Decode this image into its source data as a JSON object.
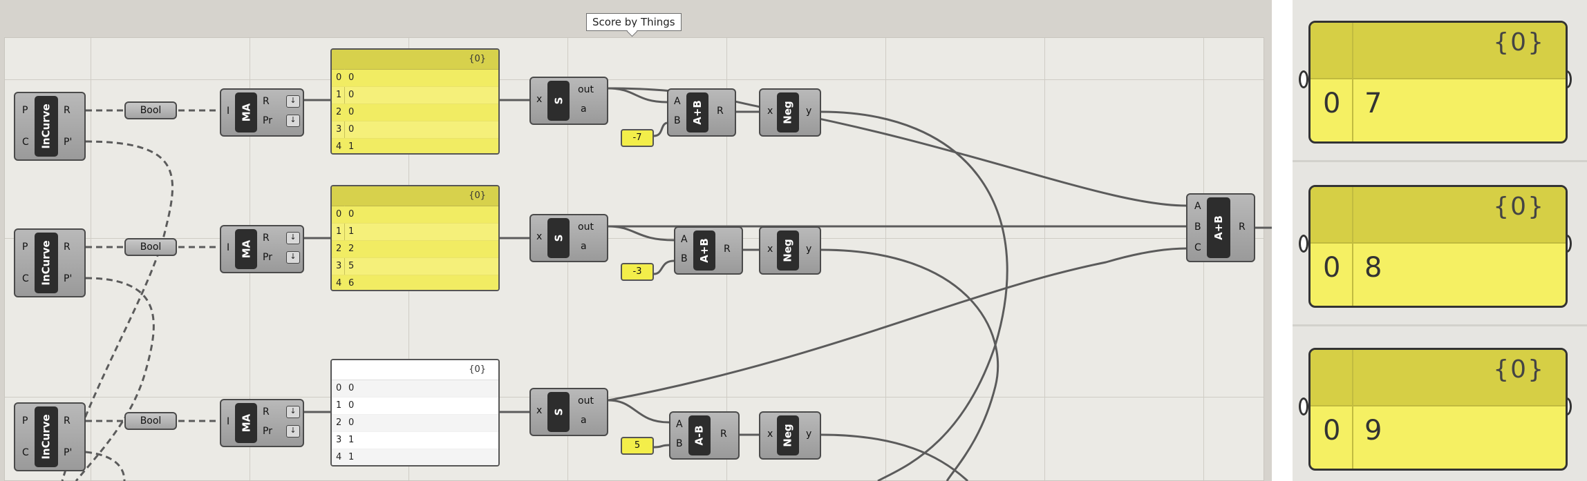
{
  "tooltip": "Score by Things",
  "incurve": {
    "title": "InCurve",
    "in_p": "P",
    "in_c": "C",
    "out_r": "R",
    "out_p": "P'"
  },
  "bool_label": "Bool",
  "ma": {
    "title": "MA",
    "in_i": "I",
    "out_r": "R",
    "out_pr": "Pr",
    "arrow": "↓"
  },
  "split": {
    "title": "S",
    "in_x": "x",
    "out_out": "out",
    "out_a": "a"
  },
  "neg": {
    "title": "Neg",
    "in_x": "x",
    "out_y": "y"
  },
  "add": {
    "title": "A+B",
    "in_a": "A",
    "in_b": "B",
    "out_r": "R"
  },
  "sub": {
    "title": "A-B"
  },
  "add3": {
    "title": "A+B",
    "in_a": "A",
    "in_b": "B",
    "in_c": "C",
    "out_r": "R"
  },
  "rows": [
    {
      "panel_header": "{0}",
      "panel": [
        {
          "i": "0",
          "v": "0"
        },
        {
          "i": "1",
          "v": "0"
        },
        {
          "i": "2",
          "v": "0"
        },
        {
          "i": "3",
          "v": "0"
        },
        {
          "i": "4",
          "v": "1"
        }
      ],
      "number": "-7"
    },
    {
      "panel_header": "{0}",
      "panel": [
        {
          "i": "0",
          "v": "0"
        },
        {
          "i": "1",
          "v": "1"
        },
        {
          "i": "2",
          "v": "2"
        },
        {
          "i": "3",
          "v": "5"
        },
        {
          "i": "4",
          "v": "6"
        }
      ],
      "number": "-3"
    },
    {
      "panel_header": "{0}",
      "panel": [
        {
          "i": "0",
          "v": "0"
        },
        {
          "i": "1",
          "v": "0"
        },
        {
          "i": "2",
          "v": "0"
        },
        {
          "i": "3",
          "v": "1"
        },
        {
          "i": "4",
          "v": "1"
        }
      ],
      "number": "5"
    }
  ],
  "results": [
    {
      "header": "{0}",
      "index": "0",
      "value": "7"
    },
    {
      "header": "{0}",
      "index": "0",
      "value": "8"
    },
    {
      "header": "{0}",
      "index": "0",
      "value": "9"
    }
  ],
  "colors": {
    "panel_yellow": "#f5f07a",
    "panel_header": "#d7d14c",
    "component_dark": "#2d2d2d",
    "wire": "#5b5b5b"
  }
}
